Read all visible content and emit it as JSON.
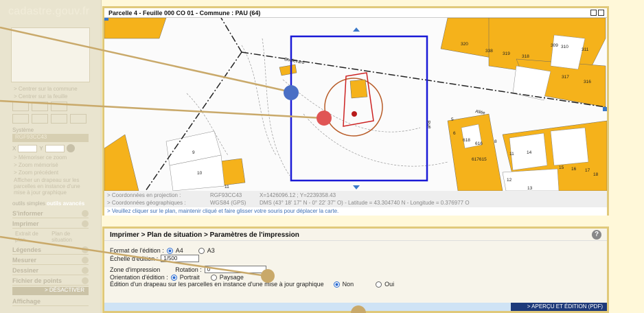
{
  "sidebar": {
    "logo": "cadastre.gouv.fr",
    "nav": [
      "> Centrer sur la commune",
      "> Centrer sur la feuille"
    ],
    "system_label": "Système",
    "system_value": "RGF93CC43",
    "x_label": "X",
    "y_label": "Y",
    "zoom_links": [
      "> Mémoriser ce zoom",
      "> Zoom mémorisé",
      "> Zoom précédent"
    ],
    "flag_text": "Afficher un drapeau sur les parcelles en instance d'une mise à jour graphique",
    "tabs": [
      "outils simples",
      "outils avancés"
    ],
    "sections": [
      "S'informer",
      "Imprimer"
    ],
    "print_subs": [
      "Extrait de plan",
      "Plan de situation"
    ],
    "sections2": [
      "Légendes",
      "Mesurer",
      "Dessiner",
      "Fichier de points"
    ],
    "desactiver": "> DÉSACTIVER",
    "affichage": "Affichage"
  },
  "map_panel": {
    "title": "Parcelle 4 - Feuille 000 CO 01 - Commune : PAU (64)",
    "coords_proj_label": "> Coordonnées en projection :",
    "coords_proj_sys": "RGF93CC43",
    "coords_proj_value": "X=1426096.12 ; Y=2239358.43",
    "coords_geo_label": "> Coordonnées géographiques :",
    "coords_geo_sys": "WGS84 (GPS)",
    "coords_geo_value": "DMS (43° 18' 17\" N - 0° 22' 37\" O) - Latitude = 43.304740 N - Longitude = 0.376977 O",
    "hint": "> Veuillez cliquer sur le plan, maintenir cliqué et faire glisser votre souris pour déplacer la carte."
  },
  "map_labels": {
    "street": "Boulevard",
    "street2": "Rue",
    "allee": "Allée",
    "numbers": [
      "320",
      "338",
      "319",
      "318",
      "309",
      "310",
      "311",
      "317",
      "316",
      "5",
      "6",
      "618",
      "616",
      "8",
      "617615",
      "11",
      "14",
      "15",
      "16",
      "17",
      "18",
      "12",
      "13",
      "9",
      "10",
      "11"
    ]
  },
  "print_panel": {
    "title": "Imprimer > Plan de situation > Paramètres de l'impression",
    "format_label": "Format de l'édition :",
    "format_a4": "A4",
    "format_a3": "A3",
    "echelle_label": "Échelle d'édition :",
    "echelle_value": "1/500",
    "zone_label": "Zone d'impression",
    "rotation_label": "Rotation :",
    "rotation_value": "0°",
    "orientation_label": "Orientation d'édition :",
    "portrait": "Portrait",
    "paysage": "Paysage",
    "drapeau_label": "Édition d'un drapeau sur les parcelles en instance d'une mise à jour graphique",
    "non": "Non",
    "oui": "Oui",
    "apercu": "> APERÇU ET ÉDITION (PDF)",
    "help": "?"
  },
  "colors": {
    "building": "#f5b21b",
    "frame": "#e0c97a",
    "selection": "#1a1ad6",
    "annotation_line": "#c9a96a",
    "marker_blue": "#4a6fc5",
    "marker_red": "#e05555"
  }
}
